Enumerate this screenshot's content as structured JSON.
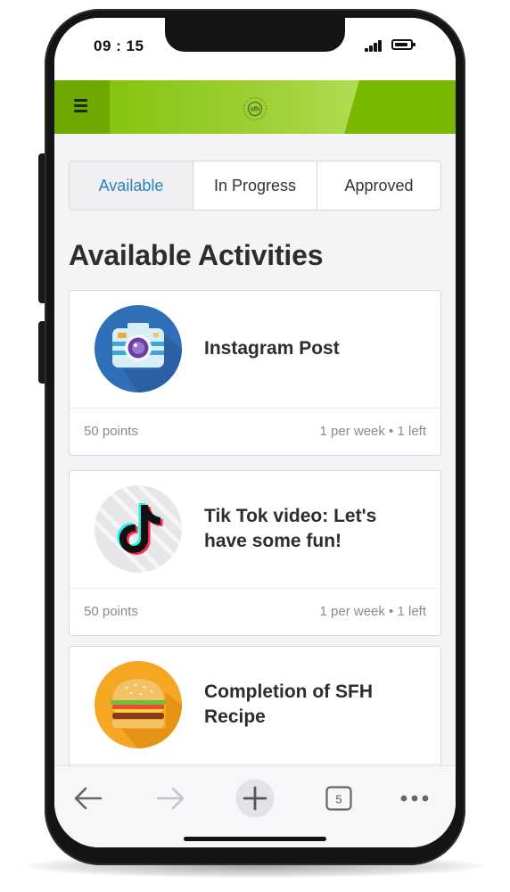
{
  "status_bar": {
    "time": "09 : 15",
    "signal_icon": "signal-bars-icon",
    "battery_icon": "battery-icon"
  },
  "app_bar": {
    "menu_icon": "hamburger-menu-icon",
    "logo_icon": "sfh-logo-icon",
    "logo_text": "sfh",
    "color": "#7ab800"
  },
  "tabs": [
    {
      "label": "Available",
      "active": true
    },
    {
      "label": "In Progress",
      "active": false
    },
    {
      "label": "Approved",
      "active": false
    }
  ],
  "section_title": "Available Activities",
  "activities": [
    {
      "title": "Instagram Post",
      "icon": "camera-icon",
      "points": "50 points",
      "frequency": "1 per week • 1 left"
    },
    {
      "title": "Tik Tok video: Let's have some fun!",
      "icon": "tiktok-icon",
      "points": "50 points",
      "frequency": "1 per week • 1 left"
    },
    {
      "title": "Completion of SFH Recipe",
      "icon": "burger-icon",
      "points": "",
      "frequency": ""
    }
  ],
  "browser_toolbar": {
    "back_icon": "back-arrow-icon",
    "forward_icon": "forward-arrow-icon",
    "new_tab_icon": "plus-icon",
    "tab_count": "5",
    "more_icon": "more-dots-icon"
  },
  "colors": {
    "accent_green": "#7ab800",
    "active_tab_text": "#2b7fc1"
  }
}
